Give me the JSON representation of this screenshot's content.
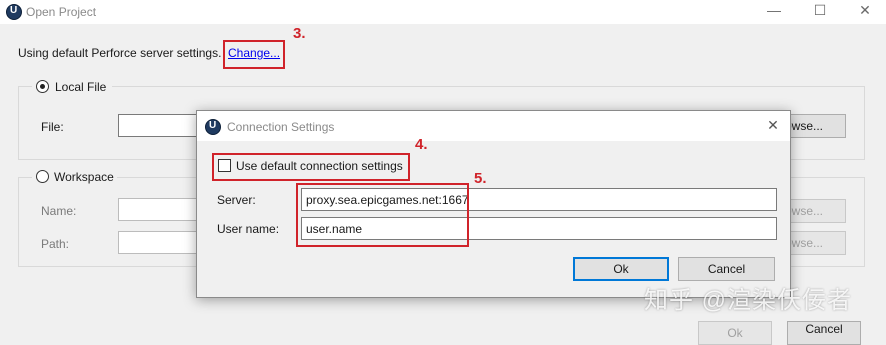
{
  "window": {
    "title": "Open Project",
    "minimize_glyph": "—",
    "maximize_glyph": "☐",
    "close_glyph": "✕"
  },
  "perforce": {
    "status_text": "Using default Perforce server settings.",
    "change_link": "Change...",
    "annotation": "3."
  },
  "local_file": {
    "label": "Local File",
    "selected": true,
    "file_label": "File:",
    "file_value": "",
    "browse_label": "Browse..."
  },
  "workspace": {
    "label": "Workspace",
    "selected": false,
    "name_label": "Name:",
    "path_label": "Path:",
    "browse_name_label": "Browse...",
    "browse_path_label": "Browse..."
  },
  "footer": {
    "ok_label": "Ok",
    "cancel_label": "Cancel"
  },
  "connection_dialog": {
    "title": "Connection Settings",
    "close_glyph": "✕",
    "use_default_label": "Use default connection settings",
    "use_default_checked": false,
    "annotation_checkbox": "4.",
    "annotation_fields": "5.",
    "server_label": "Server:",
    "server_value": "proxy.sea.epicgames.net:1667",
    "username_label": "User name:",
    "username_value": "user.name",
    "ok_label": "Ok",
    "cancel_label": "Cancel"
  },
  "watermark": "知乎 @渲染仸佞者",
  "colors": {
    "annotation_red": "#d0232a",
    "link_blue": "#0000ee",
    "focus_blue": "#0078d7"
  }
}
